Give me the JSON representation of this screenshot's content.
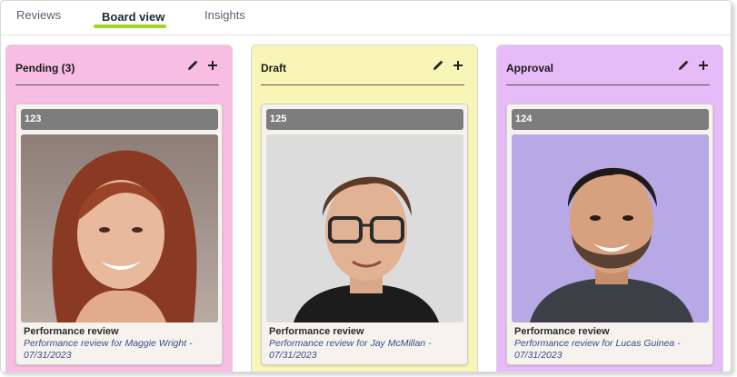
{
  "tabs": [
    {
      "label": "Reviews",
      "active": false
    },
    {
      "label": "Board view",
      "active": true
    },
    {
      "label": "Insights",
      "active": false
    }
  ],
  "colors": {
    "accent_underline": "#a4d22a",
    "pending_bg": "#f7bde3",
    "draft_bg": "#f8f6b6",
    "approval_bg": "#e7bbf7"
  },
  "columns": [
    {
      "title": "Pending (3)",
      "actions": [
        "pencil-icon",
        "plus-icon"
      ],
      "card": {
        "id": "123",
        "title": "Performance review",
        "subtitle": "Performance review for Maggie Wright - 07/31/2023",
        "photo": "woman with long red hair smiling"
      }
    },
    {
      "title": "Draft",
      "actions": [
        "pencil-icon",
        "plus-icon"
      ],
      "card": {
        "id": "125",
        "title": "Performance review",
        "subtitle": "Performance review for Jay McMillan - 07/31/2023",
        "photo": "man with glasses and short brown hair"
      }
    },
    {
      "title": "Approval",
      "actions": [
        "pencil-icon",
        "plus-icon"
      ],
      "card": {
        "id": "124",
        "title": "Performance review",
        "subtitle": "Performance review for Lucas Guinea - 07/31/2023",
        "photo": "smiling man with beard on purple background"
      }
    }
  ]
}
